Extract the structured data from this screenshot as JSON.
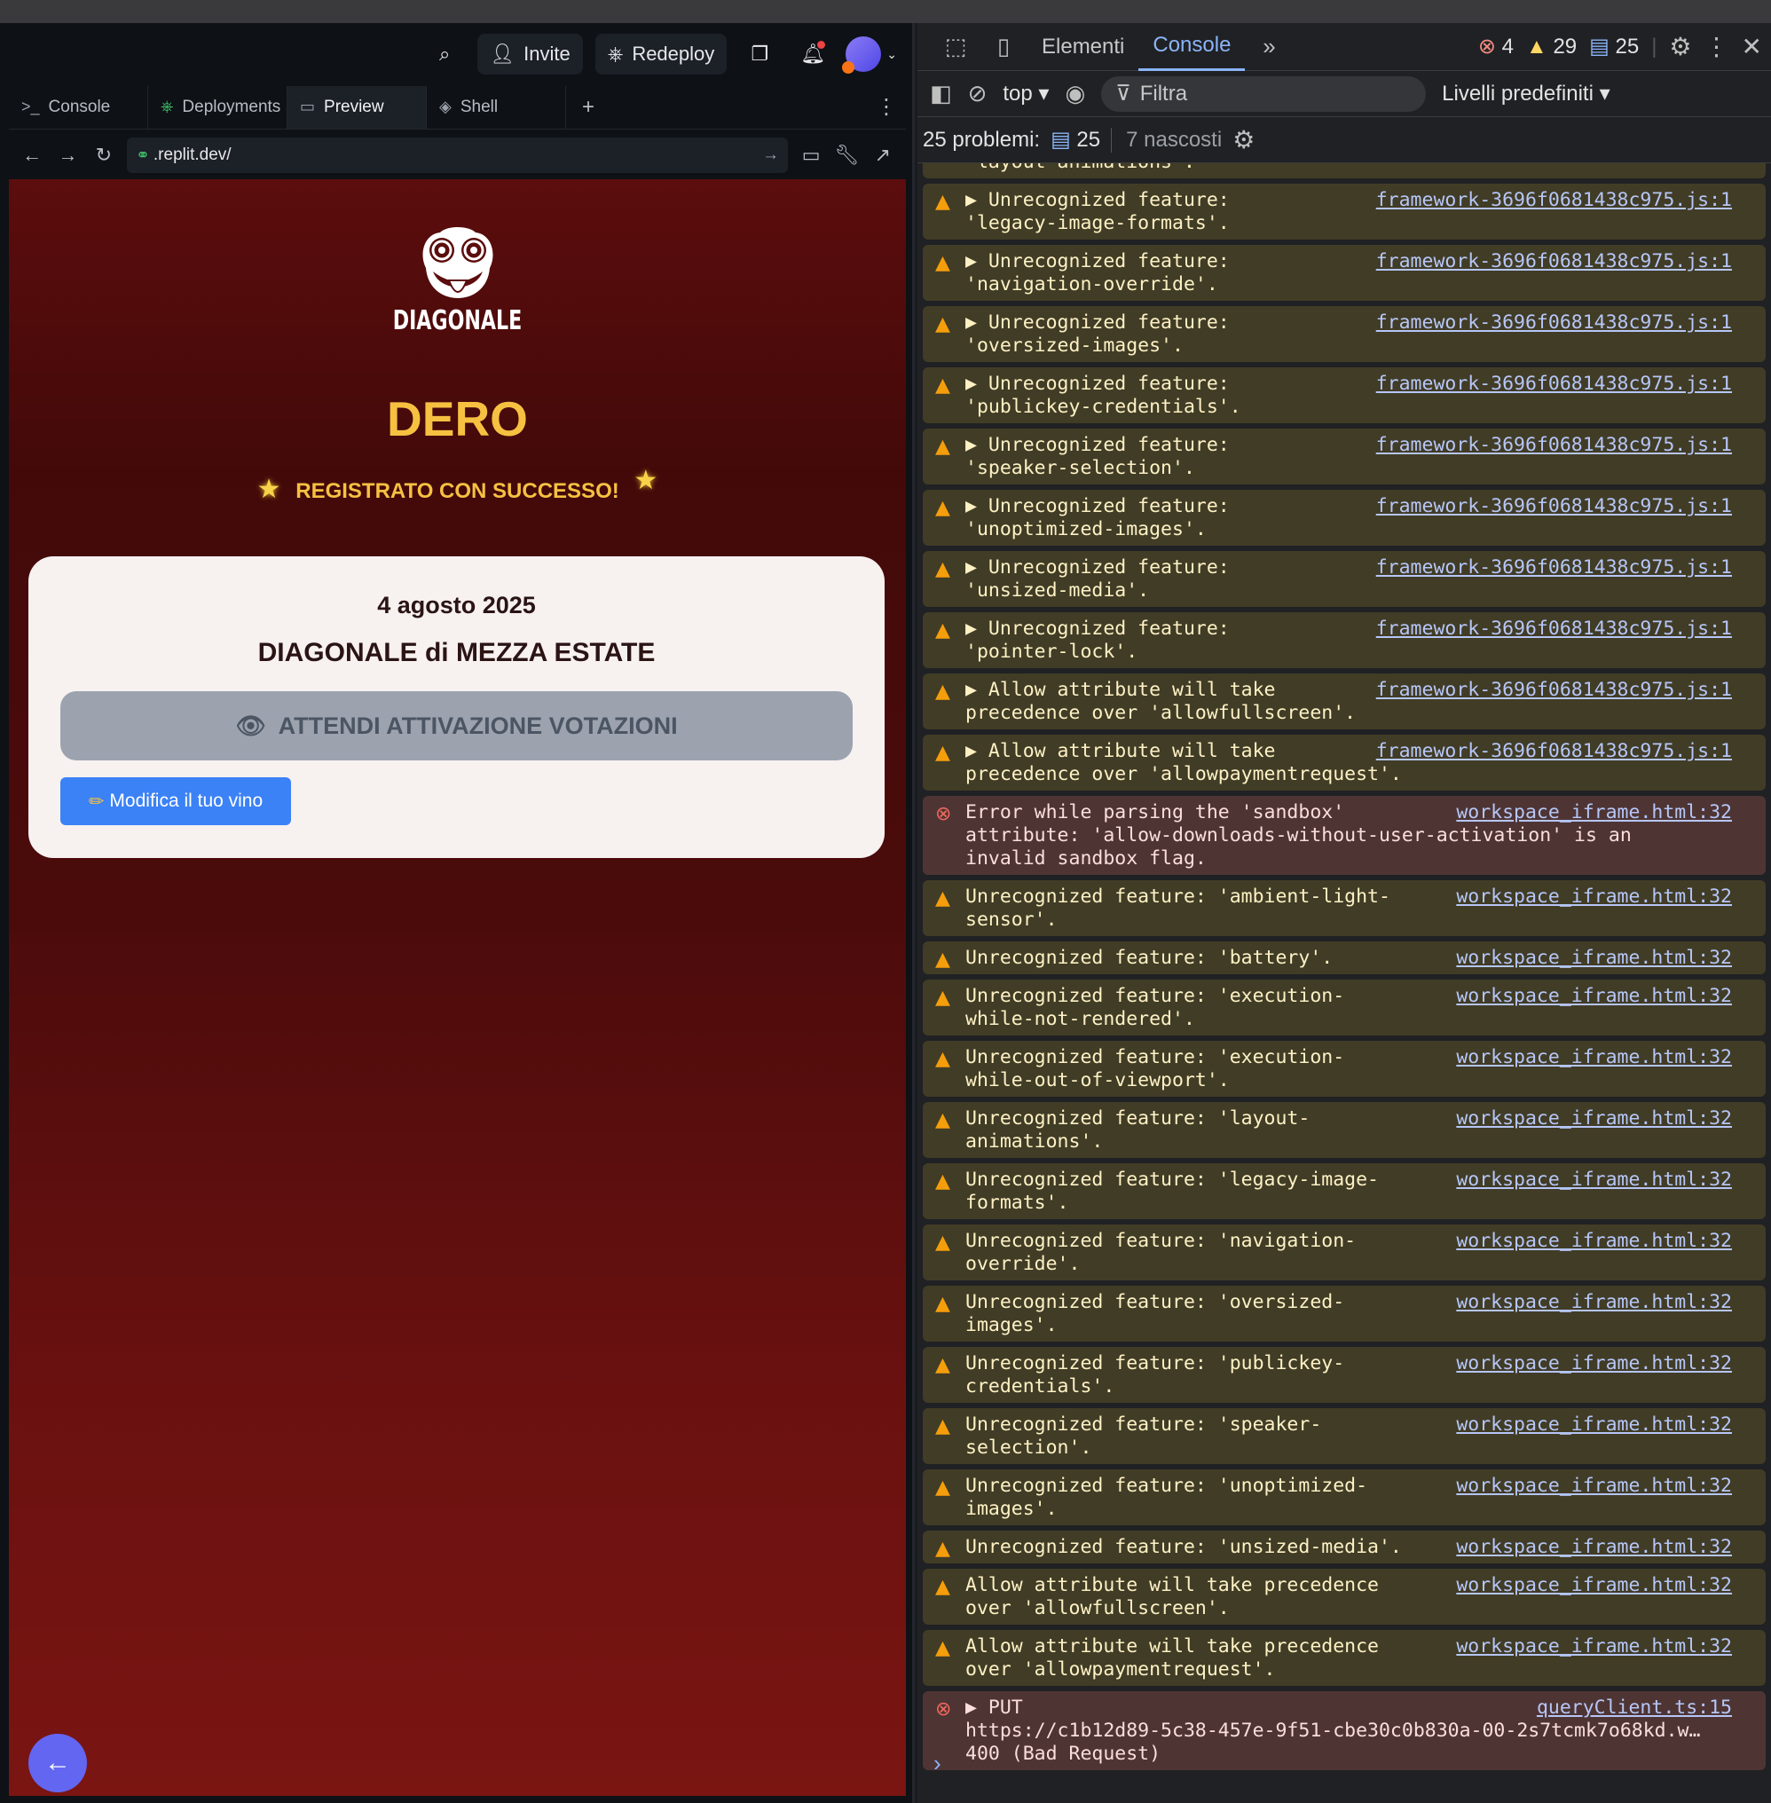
{
  "replit": {
    "topbar": {
      "invite_label": "Invite",
      "redeploy_label": "Redeploy"
    },
    "tabs": [
      {
        "label": "Console",
        "icon": "terminal-icon"
      },
      {
        "label": "Deployments",
        "icon": "deploy-icon"
      },
      {
        "label": "Preview",
        "icon": "monitor-icon"
      },
      {
        "label": "Shell",
        "icon": "shell-icon"
      }
    ],
    "url": ".replit.dev/"
  },
  "app": {
    "logo_text": "DIAGONALE",
    "username": "DERO",
    "success_message": "REGISTRATO CON SUCCESSO!",
    "card": {
      "date": "4 agosto 2025",
      "event_name": "DIAGONALE di MEZZA ESTATE",
      "wait_button_label": "ATTENDI ATTIVAZIONE VOTAZIONI",
      "edit_button_label": "Modifica il tuo vino"
    }
  },
  "devtools": {
    "tabs": [
      "Elementi",
      "Console"
    ],
    "counts": {
      "errors": "4",
      "warnings": "29",
      "info": "25"
    },
    "context": "top",
    "filter_placeholder": "Filtra",
    "levels_label": "Livelli predefiniti",
    "issues_label": "25 problemi:",
    "issues_count": "25",
    "hidden_label": "7 nascosti",
    "messages": [
      {
        "level": "warn",
        "text": "'layout-animations'.",
        "source": "",
        "partial": true
      },
      {
        "level": "warn",
        "text": "▶ Unrecognized feature:\n'legacy-image-formats'.",
        "source": "framework-3696f0681438c975.js:1"
      },
      {
        "level": "warn",
        "text": "▶ Unrecognized feature:\n'navigation-override'.",
        "source": "framework-3696f0681438c975.js:1"
      },
      {
        "level": "warn",
        "text": "▶ Unrecognized feature:\n'oversized-images'.",
        "source": "framework-3696f0681438c975.js:1"
      },
      {
        "level": "warn",
        "text": "▶ Unrecognized feature:\n'publickey-credentials'.",
        "source": "framework-3696f0681438c975.js:1"
      },
      {
        "level": "warn",
        "text": "▶ Unrecognized feature:\n'speaker-selection'.",
        "source": "framework-3696f0681438c975.js:1"
      },
      {
        "level": "warn",
        "text": "▶ Unrecognized feature:\n'unoptimized-images'.",
        "source": "framework-3696f0681438c975.js:1"
      },
      {
        "level": "warn",
        "text": "▶ Unrecognized feature:\n'unsized-media'.",
        "source": "framework-3696f0681438c975.js:1"
      },
      {
        "level": "warn",
        "text": "▶ Unrecognized feature:\n'pointer-lock'.",
        "source": "framework-3696f0681438c975.js:1"
      },
      {
        "level": "warn",
        "text": "▶ Allow attribute will take\nprecedence over 'allowfullscreen'.",
        "source": "framework-3696f0681438c975.js:1"
      },
      {
        "level": "warn",
        "text": "▶ Allow attribute will take\nprecedence over 'allowpaymentrequest'.",
        "source": "framework-3696f0681438c975.js:1"
      },
      {
        "level": "err",
        "text": "Error while parsing the 'sandbox'\nattribute: 'allow-downloads-without-user-activation' is an\ninvalid sandbox flag.",
        "source": "workspace_iframe.html:32"
      },
      {
        "level": "warn",
        "text": "Unrecognized feature: 'ambient-light-\nsensor'.",
        "source": "workspace_iframe.html:32"
      },
      {
        "level": "warn",
        "text": "Unrecognized feature: 'battery'.",
        "source": "workspace_iframe.html:32"
      },
      {
        "level": "warn",
        "text": "Unrecognized feature: 'execution-\nwhile-not-rendered'.",
        "source": "workspace_iframe.html:32"
      },
      {
        "level": "warn",
        "text": "Unrecognized feature: 'execution-\nwhile-out-of-viewport'.",
        "source": "workspace_iframe.html:32"
      },
      {
        "level": "warn",
        "text": "Unrecognized feature: 'layout-\nanimations'.",
        "source": "workspace_iframe.html:32"
      },
      {
        "level": "warn",
        "text": "Unrecognized feature: 'legacy-image-\nformats'.",
        "source": "workspace_iframe.html:32"
      },
      {
        "level": "warn",
        "text": "Unrecognized feature: 'navigation-\noverride'.",
        "source": "workspace_iframe.html:32"
      },
      {
        "level": "warn",
        "text": "Unrecognized feature: 'oversized-\nimages'.",
        "source": "workspace_iframe.html:32"
      },
      {
        "level": "warn",
        "text": "Unrecognized feature: 'publickey-\ncredentials'.",
        "source": "workspace_iframe.html:32"
      },
      {
        "level": "warn",
        "text": "Unrecognized feature: 'speaker-\nselection'.",
        "source": "workspace_iframe.html:32"
      },
      {
        "level": "warn",
        "text": "Unrecognized feature: 'unoptimized-\nimages'.",
        "source": "workspace_iframe.html:32"
      },
      {
        "level": "warn",
        "text": "Unrecognized feature: 'unsized-media'.",
        "source": "workspace_iframe.html:32"
      },
      {
        "level": "warn",
        "text": "Allow attribute will take precedence\nover 'allowfullscreen'.",
        "source": "workspace_iframe.html:32"
      },
      {
        "level": "warn",
        "text": "Allow attribute will take precedence\nover 'allowpaymentrequest'.",
        "source": "workspace_iframe.html:32"
      },
      {
        "level": "err",
        "text": "▶ PUT\nhttps://c1b12d89-5c38-457e-9f51-cbe30c0b830a-00-2s7tcmk7o68kd.w…\n400 (Bad Request)",
        "source": "queryClient.ts:15"
      }
    ]
  }
}
